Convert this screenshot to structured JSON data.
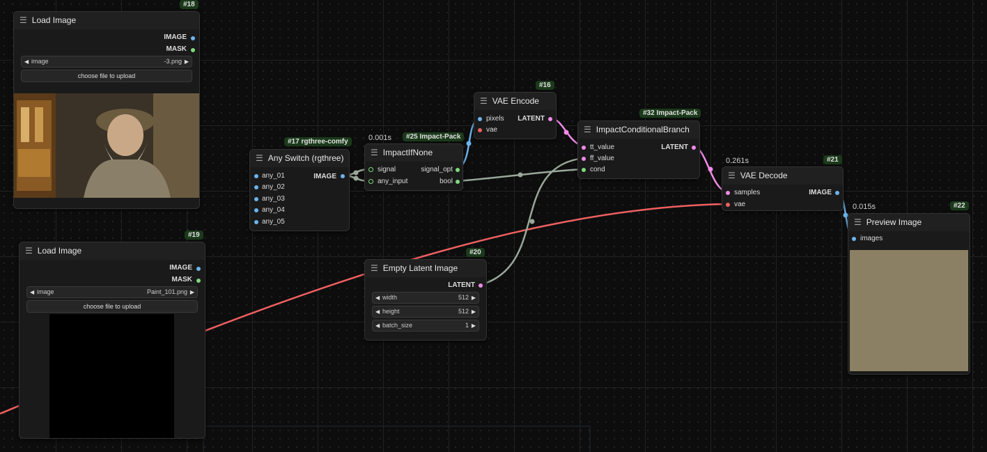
{
  "nodes": {
    "load_image_18": {
      "badge": "#18",
      "title": "Load Image",
      "outputs": [
        "IMAGE",
        "MASK"
      ],
      "image_label": "image",
      "image_value": "-3.png",
      "upload_label": "choose file to upload"
    },
    "load_image_19": {
      "badge": "#19",
      "title": "Load Image",
      "outputs": [
        "IMAGE",
        "MASK"
      ],
      "image_label": "image",
      "image_value": "Paint_101.png",
      "upload_label": "choose file to upload"
    },
    "any_switch_17": {
      "badge": "#17 rgthree-comfy",
      "title": "Any Switch (rgthree)",
      "inputs": [
        "any_01",
        "any_02",
        "any_03",
        "any_04",
        "any_05"
      ],
      "output": "IMAGE"
    },
    "impact_if_none_25": {
      "badge": "#25 Impact-Pack",
      "timing": "0.001s",
      "title": "ImpactIfNone",
      "inputs": [
        "signal",
        "any_input"
      ],
      "outputs": [
        "signal_opt",
        "bool"
      ]
    },
    "vae_encode_16": {
      "badge": "#16",
      "title": "VAE Encode",
      "inputs": [
        "pixels",
        "vae"
      ],
      "output": "LATENT"
    },
    "conditional_branch_32": {
      "badge": "#32 Impact-Pack",
      "title": "ImpactConditionalBranch",
      "inputs": [
        "tt_value",
        "ff_value",
        "cond"
      ],
      "output": "LATENT"
    },
    "vae_decode_21": {
      "badge": "#21",
      "timing": "0.261s",
      "title": "VAE Decode",
      "inputs": [
        "samples",
        "vae"
      ],
      "output": "IMAGE"
    },
    "preview_image_22": {
      "badge": "#22",
      "timing": "0.015s",
      "title": "Preview Image",
      "inputs": [
        "images"
      ],
      "preview_color": "#8b7f64"
    },
    "empty_latent_20": {
      "badge": "#20",
      "title": "Empty Latent Image",
      "output": "LATENT",
      "widgets": [
        {
          "label": "width",
          "value": "512"
        },
        {
          "label": "height",
          "value": "512"
        },
        {
          "label": "batch_size",
          "value": "1"
        }
      ]
    }
  },
  "colors": {
    "image_link": "#6cb4ee",
    "latent_link": "#f08be6",
    "vae_link": "#f06060",
    "generic_link": "#9aa89a",
    "badge_bg": "#1b3a1b",
    "canvas_bg": "#0d0d0d"
  }
}
